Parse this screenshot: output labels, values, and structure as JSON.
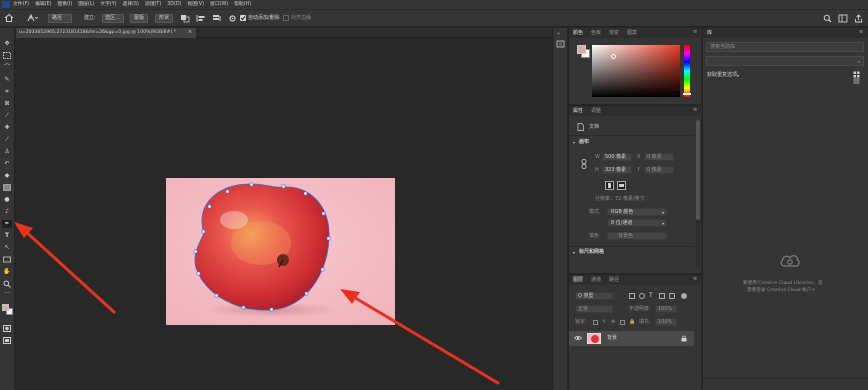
{
  "menubar": {
    "items": [
      "文件(F)",
      "编辑(E)",
      "图像(I)",
      "图层(L)",
      "文字(Y)",
      "选择(S)",
      "滤镜(T)",
      "3D(D)",
      "视图(V)",
      "窗口(W)",
      "帮助(H)"
    ]
  },
  "options": {
    "mode_value": "路径",
    "make_label": "建立:",
    "selection_btn": "选区...",
    "mask_btn": "蒙版",
    "shape_btn": "形状",
    "auto_add_delete": "自动添加/删除",
    "align_edges": "对齐边缘",
    "auto_checked": true
  },
  "document": {
    "tab_title": "u=2033652965,2723181418&fm=26&gp=0.jpg @ 100%(RGB/8#) *",
    "close_glyph": "×"
  },
  "color_panel": {
    "tabs": [
      "颜色",
      "色板",
      "渐变",
      "图案"
    ],
    "foreground": "#d9aba4",
    "hue_color": "#e83b26"
  },
  "properties_panel": {
    "tabs": [
      "属性",
      "调整"
    ],
    "doc_label": "文档",
    "section_canvas": "画布",
    "w_label": "W",
    "w_value": "500 像素",
    "h_label": "H",
    "h_value": "323 像素",
    "x_label": "X",
    "x_value": "0 像素",
    "y_label": "Y",
    "y_value": "0 像素",
    "resolution": "分辨率：72 像素/英寸",
    "mode_label": "模式",
    "mode_value": "RGB 颜色",
    "depth_value": "8 位/通道",
    "fill_label": "填色",
    "fill_value": "背景色",
    "rulers_section": "标尺和网格"
  },
  "layers_panel": {
    "tabs": [
      "图层",
      "通道",
      "路径"
    ],
    "kind_label": "Q 类型",
    "blend_mode": "正常",
    "opacity_label": "不透明度:",
    "opacity_value": "100%",
    "lock_label": "锁定:",
    "fill_label": "填充:",
    "fill_value": "100%",
    "layer_name": "背景"
  },
  "libraries_panel": {
    "tab": "库",
    "search_placeholder": "搜索当前库",
    "lib_select": "获取重复选项",
    "message_line1": "要使用 Creative Cloud Libraries，您",
    "message_line2": "需要登录 Creative Cloud 帐户>"
  }
}
